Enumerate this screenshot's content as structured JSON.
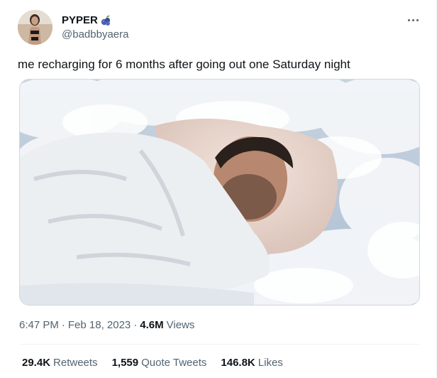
{
  "author": {
    "display_name": "PYPER",
    "name_emoji": "blueberries-emoji",
    "handle": "@badbbyaera",
    "avatar": "profile-photo"
  },
  "menu_icon": "more-horizontal-icon",
  "tweet": {
    "text": "me recharging for 6 months after going out one Saturday night",
    "media": "photo of a man sleeping in a bed surrounded by clouds"
  },
  "meta": {
    "time": "6:47 PM",
    "separator": "·",
    "date": "Feb 18, 2023",
    "views_count": "4.6M",
    "views_label": "Views"
  },
  "stats": {
    "retweets": {
      "count": "29.4K",
      "label": "Retweets"
    },
    "quote_tweets": {
      "count": "1,559",
      "label": "Quote Tweets"
    },
    "likes": {
      "count": "146.8K",
      "label": "Likes"
    }
  },
  "colors": {
    "text_primary": "#0f1419",
    "text_secondary": "#536471",
    "divider": "#eff3f4"
  }
}
